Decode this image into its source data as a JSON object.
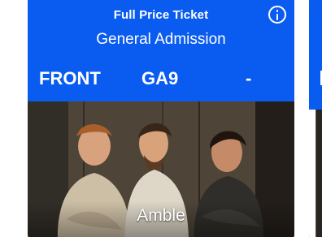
{
  "ticket": {
    "ticket_type": "Full Price Ticket",
    "admission": "General Admission",
    "info_icon": "info-icon",
    "section": "FRONT",
    "row": "GA9",
    "seat": "-",
    "event_name": "Amble",
    "colors": {
      "header_blue": "#0a5cf0",
      "text": "#ffffff"
    },
    "image": {
      "subject": "band-photo"
    }
  }
}
